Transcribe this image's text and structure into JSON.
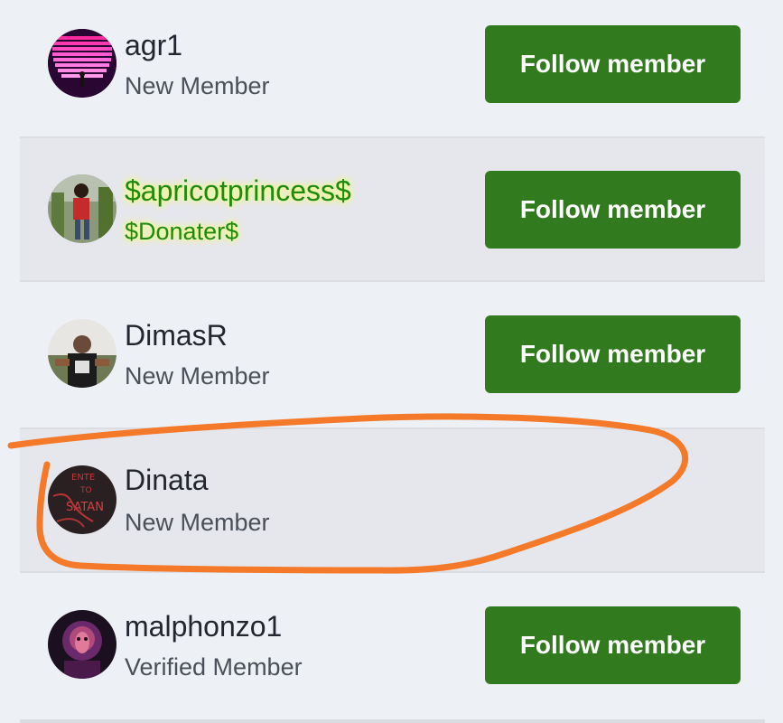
{
  "members": [
    {
      "name": "agr1",
      "role": "New Member",
      "button": "Follow member"
    },
    {
      "name": "$apricotprincess$",
      "role": "$Donater$",
      "button": "Follow member"
    },
    {
      "name": "DimasR",
      "role": "New Member",
      "button": "Follow member"
    },
    {
      "name": "Dinata",
      "role": "New Member"
    },
    {
      "name": "malphonzo1",
      "role": "Verified Member",
      "button": "Follow member"
    }
  ],
  "colors": {
    "button": "#327a1e",
    "donor_text": "#1f8a12",
    "donor_glow": "#f2ff6a",
    "annotation": "#f47a2a",
    "background": "#edf0f5"
  }
}
